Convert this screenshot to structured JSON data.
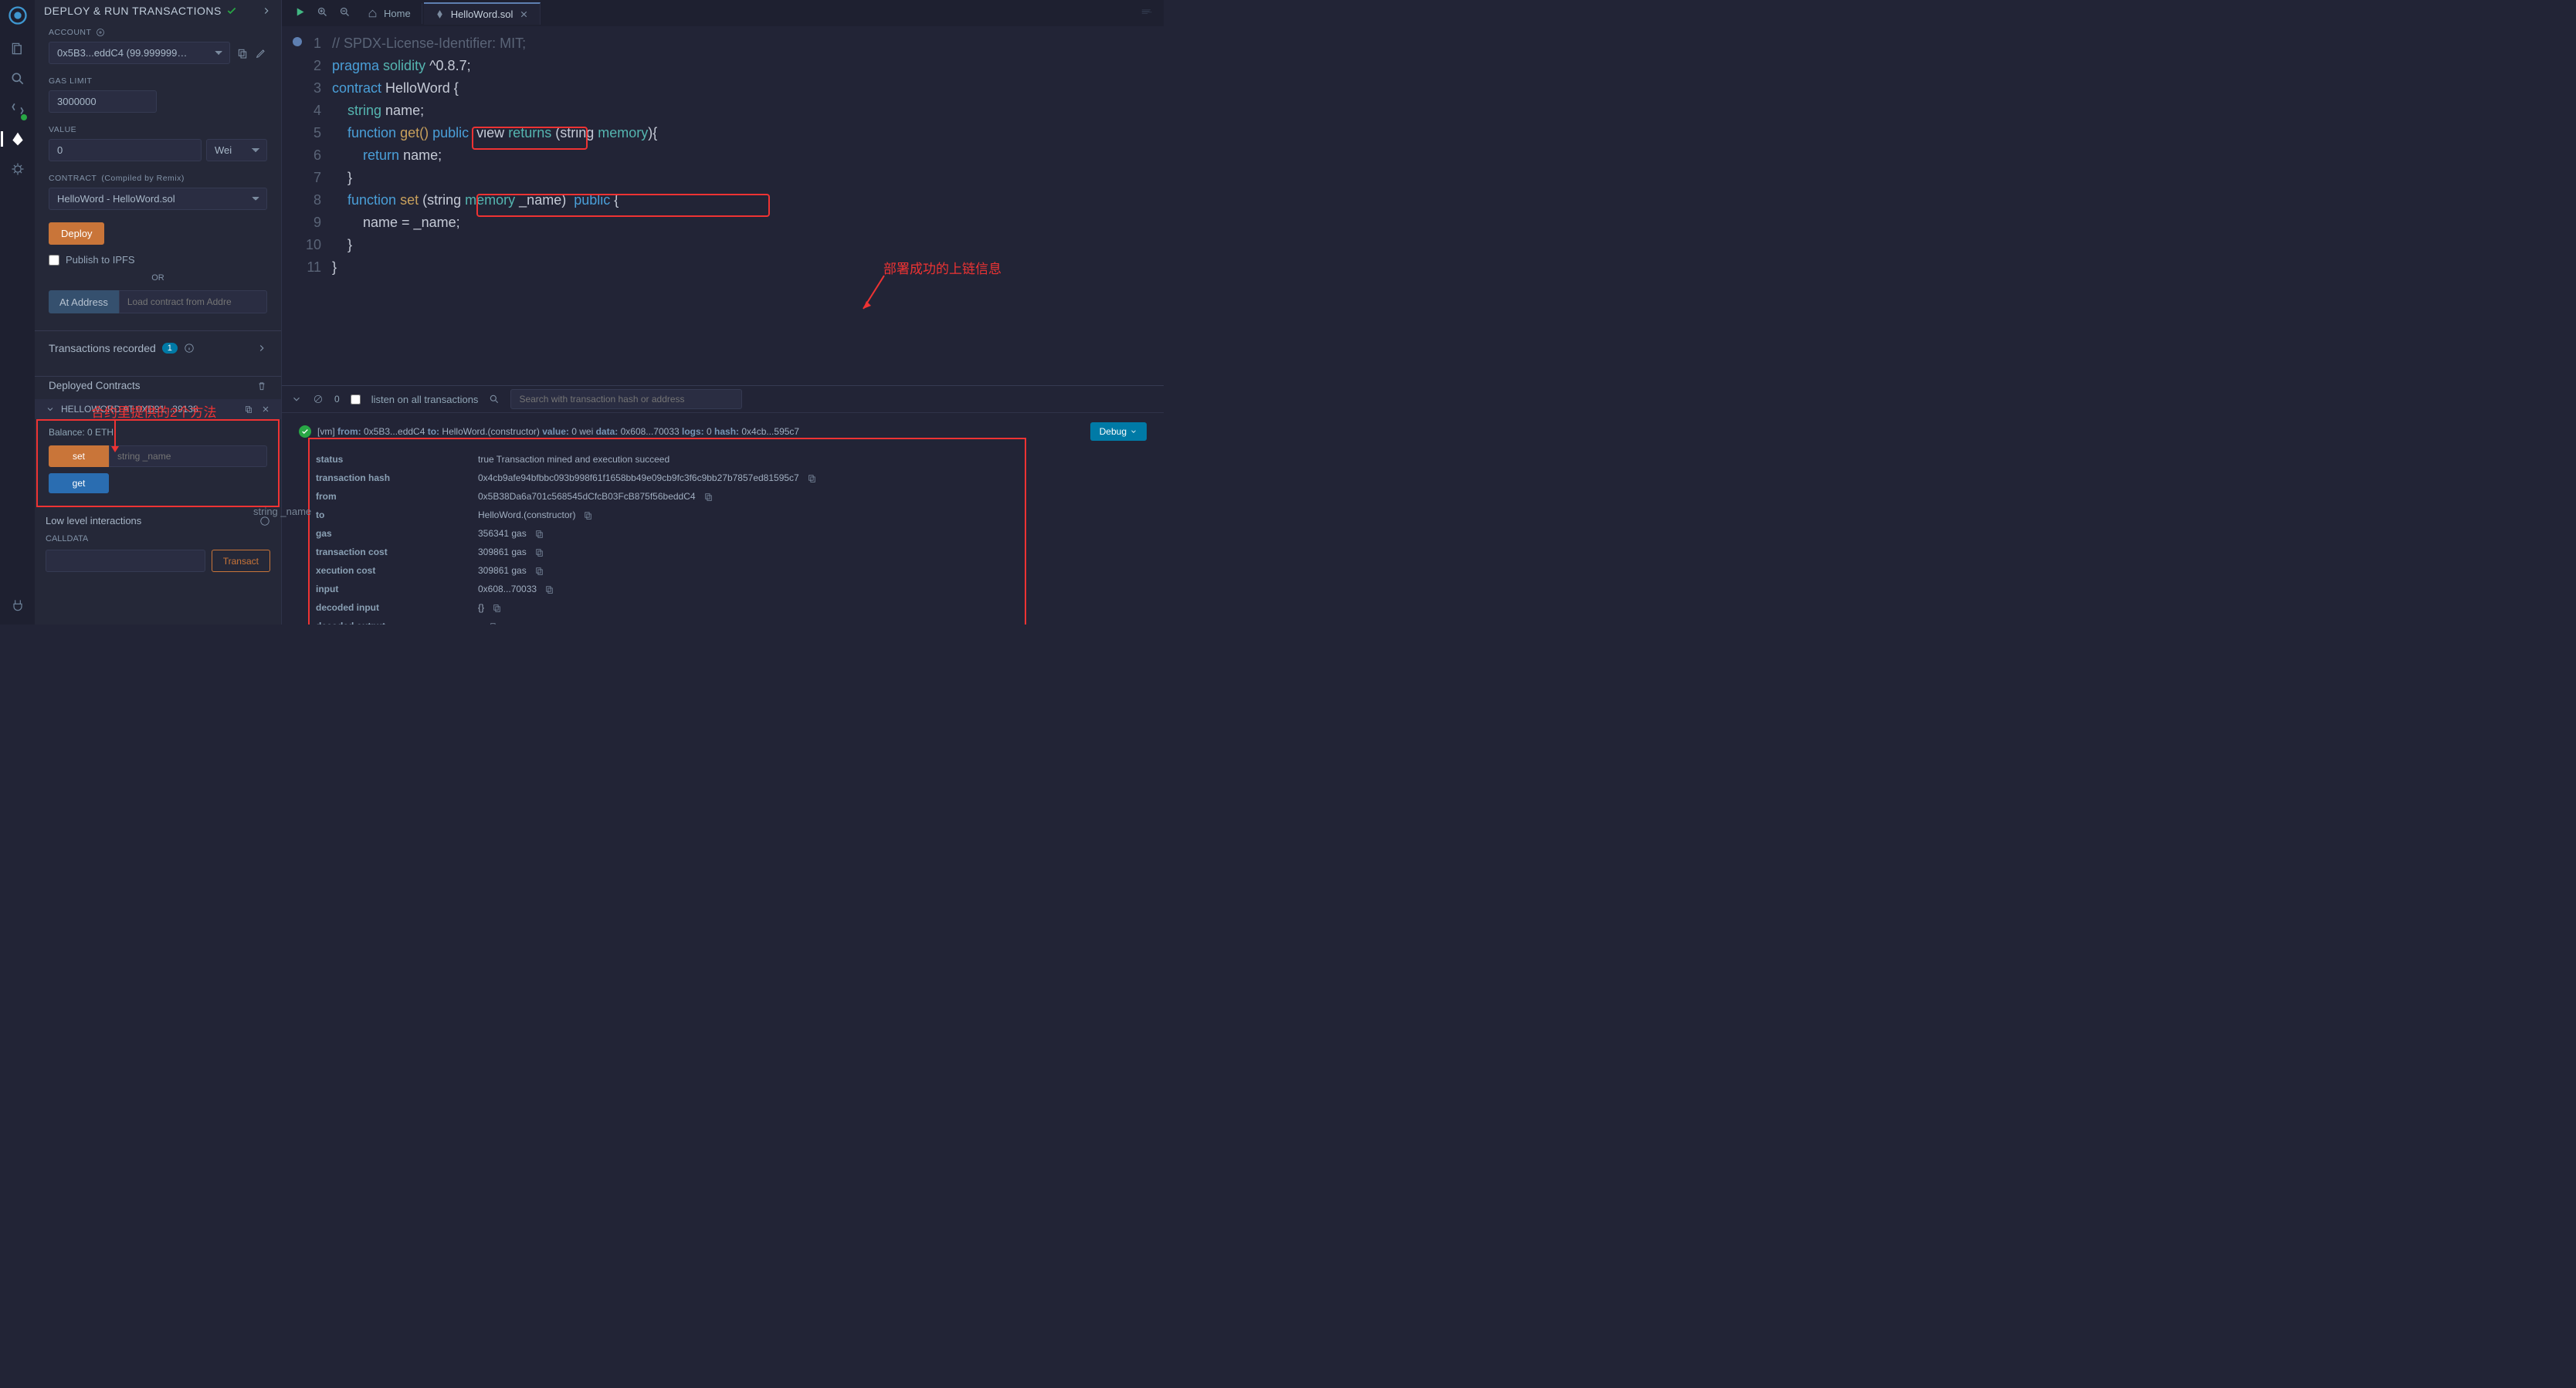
{
  "panel_title": "DEPLOY & RUN TRANSACTIONS",
  "account": {
    "label": "ACCOUNT",
    "value": "0x5B3...eddC4 (99.999999…"
  },
  "gas": {
    "label": "GAS LIMIT",
    "value": "3000000"
  },
  "value": {
    "label": "VALUE",
    "amount": "0",
    "unit": "Wei"
  },
  "contract": {
    "label": "CONTRACT",
    "note": "(Compiled by Remix)",
    "value": "HelloWord - HelloWord.sol"
  },
  "deploy_btn": "Deploy",
  "publish": "Publish to IPFS",
  "or": "OR",
  "at_address": "At Address",
  "at_placeholder": "Load contract from Addre",
  "tx_recorded": "Transactions recorded",
  "tx_badge": "1",
  "deployed": "Deployed Contracts",
  "instance": "HELLOWORD AT 0XD91...39138",
  "balance": "Balance: 0 ETH",
  "fn_set": "set",
  "fn_set_ph": "string _name",
  "fn_get": "get",
  "low": "Low level interactions",
  "calldata": "CALLDATA",
  "transact": "Transact",
  "tab_home": "Home",
  "tab_file": "HelloWord.sol",
  "listen": "listen on all transactions",
  "search_ph": "Search with transaction hash or address",
  "debug": "Debug",
  "ghost": "string _name",
  "anno1": "合约里提供的2个方法",
  "anno2": "部署成功的上链信息",
  "code": {
    "l1": "// SPDX-License-Identifier: MIT;",
    "l2_a": "pragma",
    "l2_b": "solidity",
    "l2_c": "^0.8.7;",
    "l3_a": "contract",
    "l3_b": "HelloWord",
    "l3_c": "{",
    "l4_a": "string",
    "l4_b": "name;",
    "l5_a": "function",
    "l5_b": "get()",
    "l5_c": "public",
    "l5_d": "view",
    "l5_e": "returns",
    "l5_f": "(string",
    "l5_g": "memory",
    "l6_a": "return",
    "l6_b": "name;",
    "l7": "}",
    "l8_a": "function",
    "l8_b": "set",
    "l8_c": "(string",
    "l8_d": "memory",
    "l8_e": "_name)",
    "l8_f": "public",
    "l8_g": "{",
    "l9": "name = _name;",
    "l10": "}",
    "l11": "}"
  },
  "tx": {
    "summary_from": "[vm] ",
    "k_from": "from:",
    "v_from": " 0x5B3...eddC4 ",
    "k_to": "to:",
    "v_to": " HelloWord.(constructor) ",
    "k_value": "value:",
    "v_value": " 0 wei ",
    "k_data": "data:",
    "v_data": " 0x608...70033 ",
    "k_logs": "logs:",
    "v_logs": " 0 ",
    "k_hash": "hash:",
    "v_hash": " 0x4cb...595c7",
    "rows": [
      {
        "k": "status",
        "v": "true Transaction mined and execution succeed"
      },
      {
        "k": "transaction hash",
        "v": "0x4cb9afe94bfbbc093b998f61f1658bb49e09cb9fc3f6c9bb27b7857ed81595c7",
        "copy": true
      },
      {
        "k": "from",
        "v": "0x5B38Da6a701c568545dCfcB03FcB875f56beddC4",
        "copy": true
      },
      {
        "k": "to",
        "v": "HelloWord.(constructor)",
        "copy": true
      },
      {
        "k": "gas",
        "v": "356341 gas",
        "copy": true
      },
      {
        "k": "transaction cost",
        "v": "309861 gas",
        "copy": true
      },
      {
        "k": "xecution cost",
        "v": "309861 gas",
        "copy": true
      },
      {
        "k": "input",
        "v": "0x608...70033",
        "copy": true
      },
      {
        "k": "decoded input",
        "v": "{}",
        "copy": true
      },
      {
        "k": "decoded output",
        "v": "-",
        "copy": true
      }
    ]
  }
}
